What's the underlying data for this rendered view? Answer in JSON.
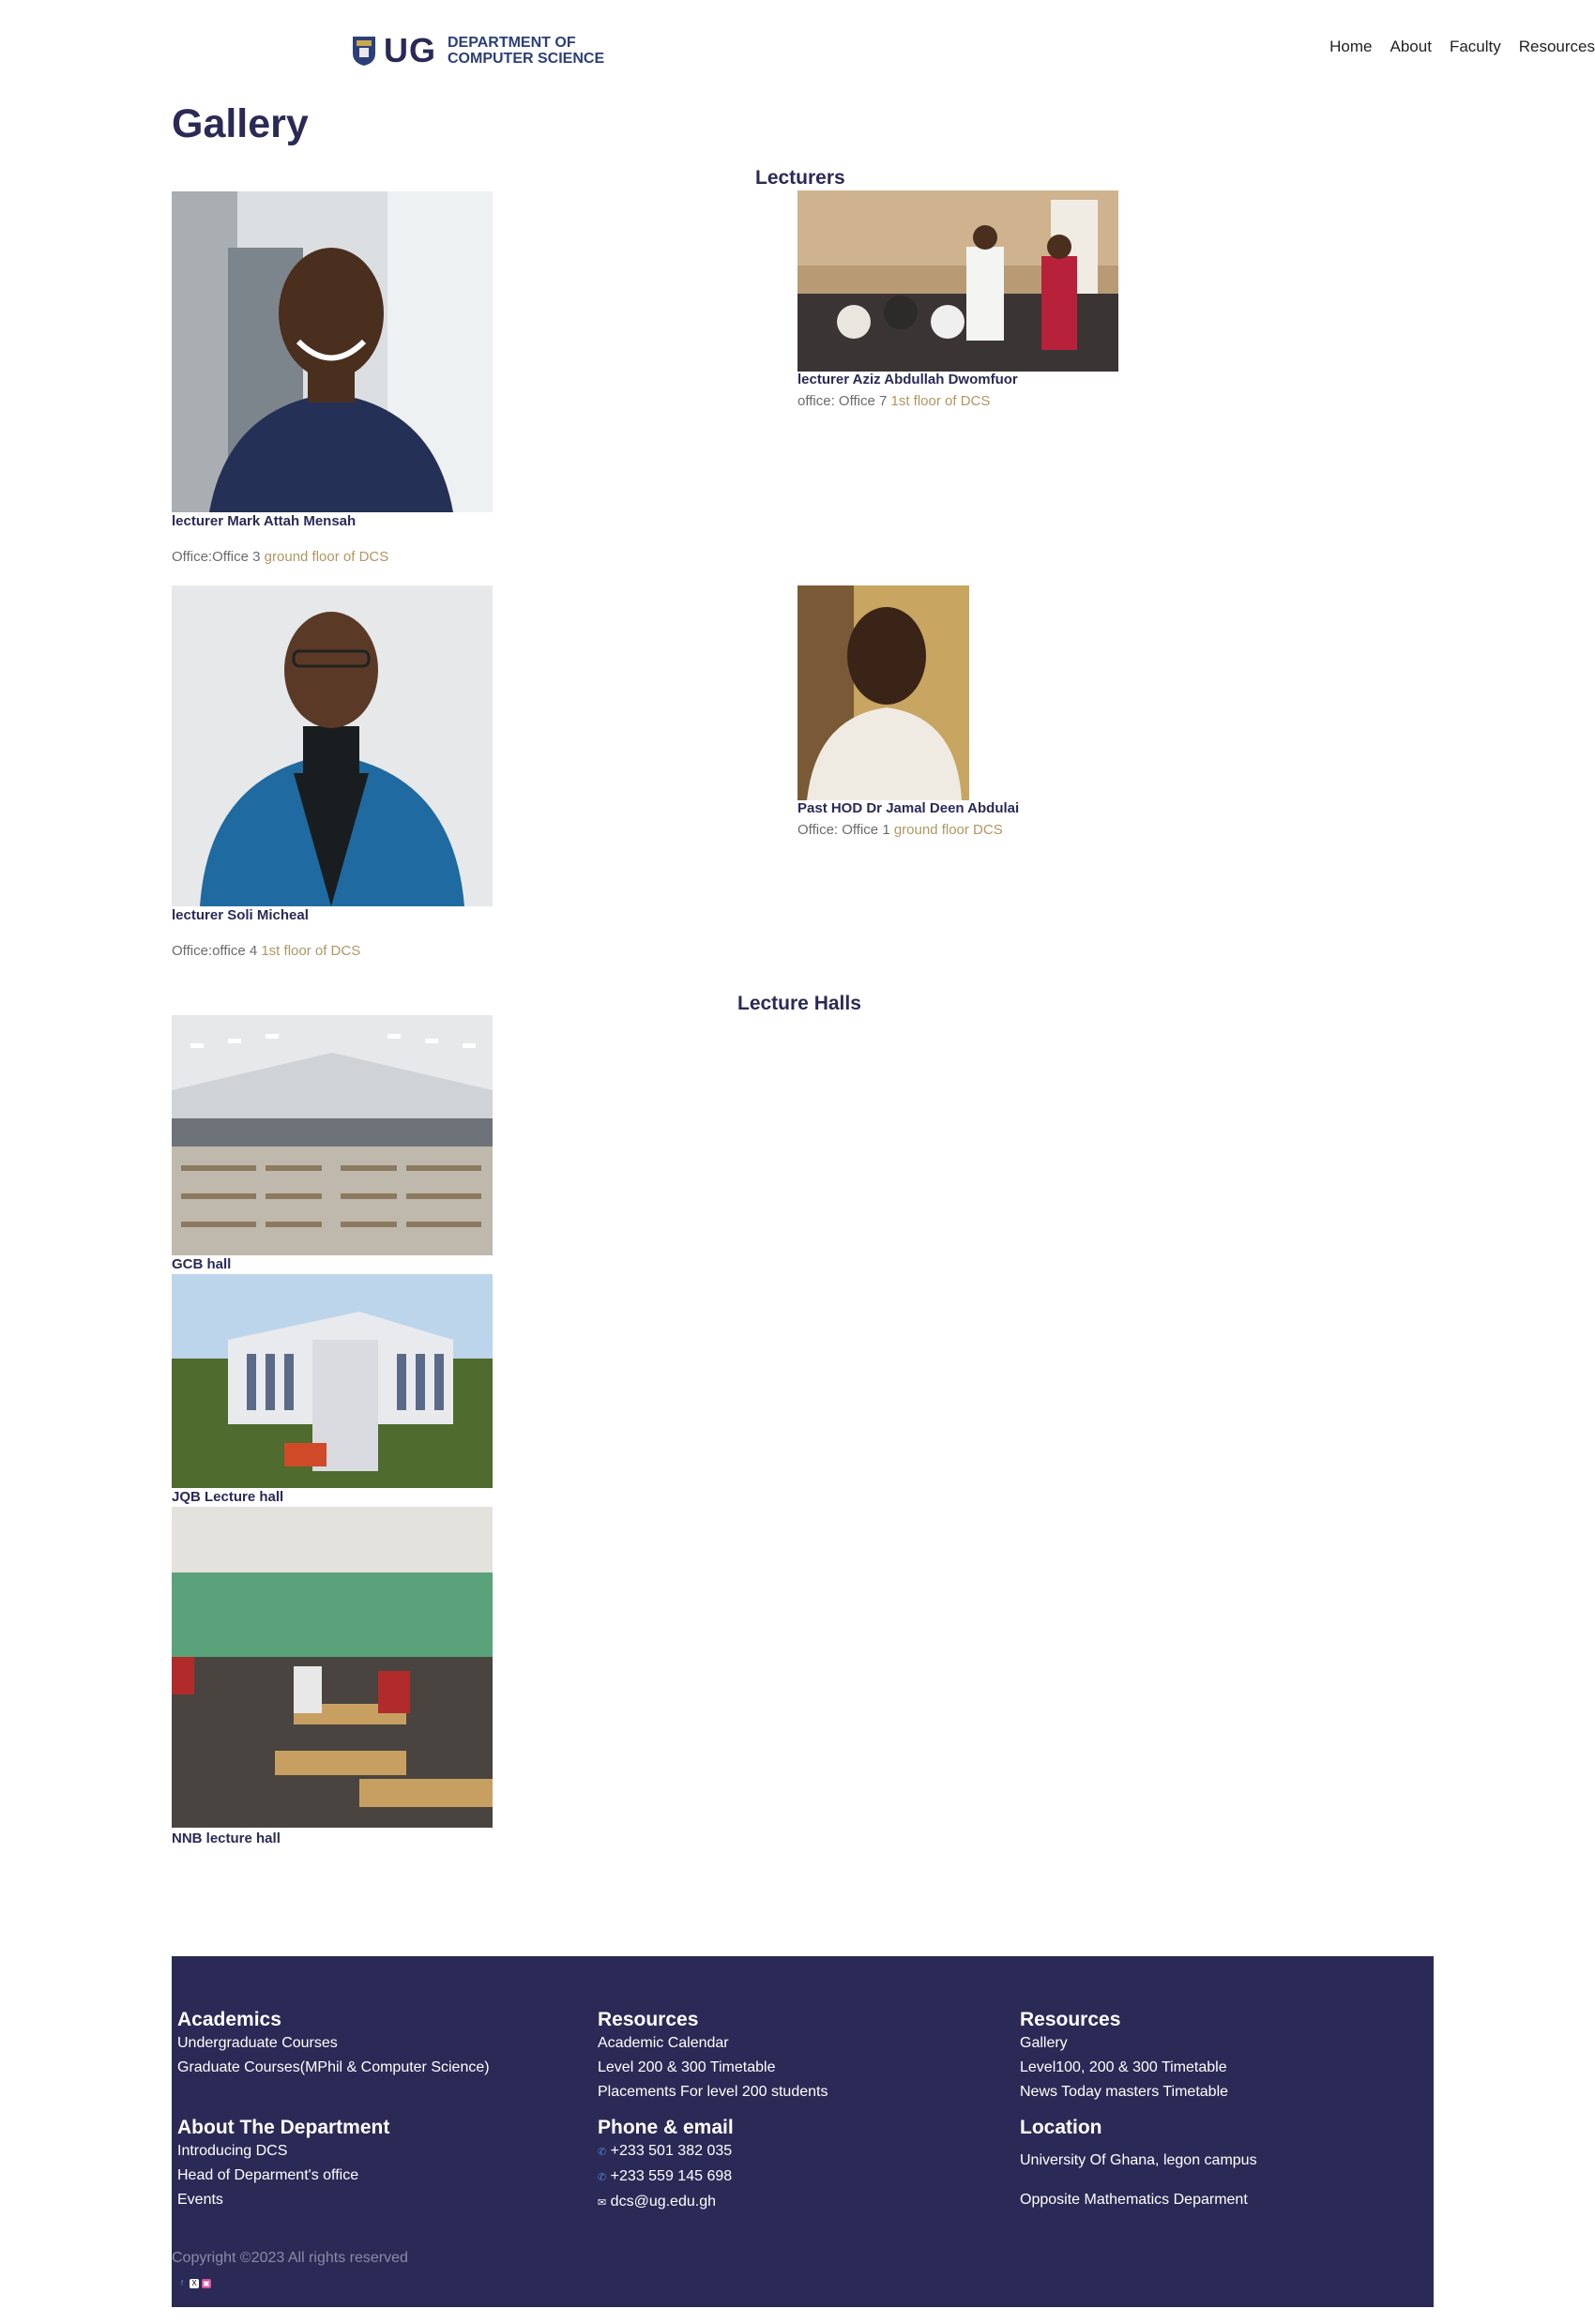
{
  "header": {
    "logo_text": "UG",
    "dept_line1": "DEPARTMENT OF",
    "dept_line2": "COMPUTER SCIENCE",
    "nav": [
      "Home",
      "About",
      "Faculty",
      "Resources"
    ]
  },
  "page_title": "Gallery",
  "lecturers": {
    "title": "Lecturers",
    "items": [
      {
        "name": "lecturer Mark Attah Mensah",
        "office": "Office:Office 3 ",
        "location": "ground floor of DCS"
      },
      {
        "name": "lecturer Aziz Abdullah Dwomfuor",
        "office": "office: Office 7 ",
        "location": "1st floor of DCS"
      },
      {
        "name": "lecturer Soli Micheal",
        "office": "Office:office 4 ",
        "location": "1st floor of DCS"
      },
      {
        "name": "Past HOD Dr Jamal Deen Abdulai",
        "office": "Office: Office 1 ",
        "location": "ground floor DCS"
      }
    ]
  },
  "lecture_halls": {
    "title": "Lecture Halls",
    "items": [
      {
        "name": "GCB hall"
      },
      {
        "name": "JQB Lecture hall"
      },
      {
        "name": "NNB lecture hall"
      }
    ]
  },
  "footer": {
    "academics": {
      "title": "Academics",
      "links": [
        "Undergraduate Courses",
        "Graduate Courses(MPhil & Computer Science)"
      ]
    },
    "resources1": {
      "title": "Resources",
      "links": [
        "Academic Calendar",
        "Level 200 & 300 Timetable",
        "Placements For level 200 students"
      ]
    },
    "resources2": {
      "title": "Resources",
      "links": [
        "Gallery",
        "Level100, 200 & 300 Timetable",
        "News Today masters Timetable"
      ]
    },
    "about": {
      "title": "About The Department",
      "links": [
        "Introducing DCS",
        "Head of Deparment's office",
        "Events"
      ]
    },
    "contact": {
      "title": "Phone & email",
      "phone1": "+233 501 382 035",
      "phone2": "+233 559 145 698",
      "email": "dcs@ug.edu.gh"
    },
    "location": {
      "title": "Location",
      "line1": "University Of Ghana, legon campus",
      "line2": "Opposite Mathematics Deparment"
    },
    "copyright": "Copyright ©2023 All rights reserved",
    "social": [
      "facebook-icon",
      "x-icon",
      "instagram-icon"
    ]
  }
}
